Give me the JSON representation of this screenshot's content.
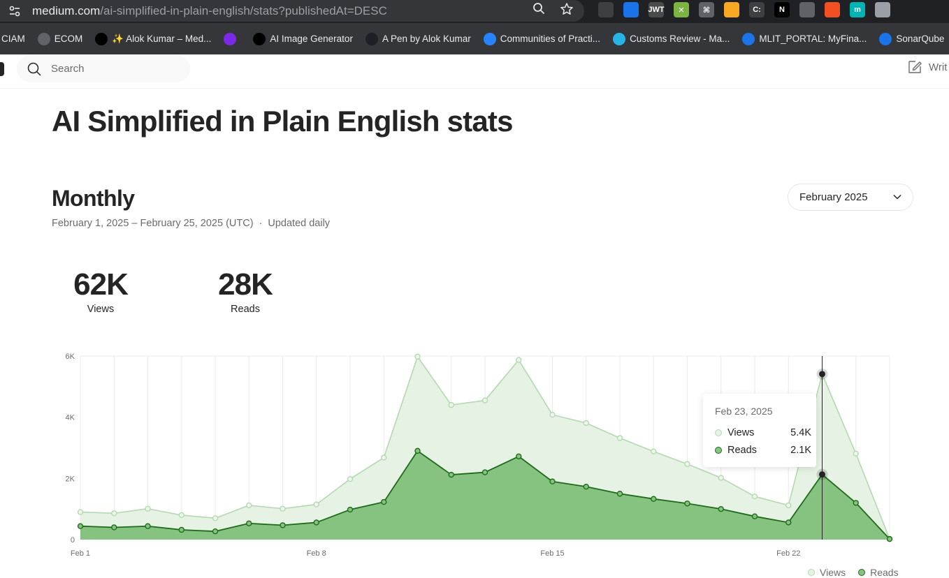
{
  "browser": {
    "url_host": "medium.com",
    "url_path": "/ai-simplified-in-plain-english/stats?publishedAt=DESC",
    "bookmarks": [
      {
        "label": "CIAM",
        "icon": "bookmark-icon",
        "color": "#35363a"
      },
      {
        "label": "ECOM",
        "icon": "globe-icon",
        "color": "#5f6368"
      },
      {
        "label": "✨ Alok Kumar – Med...",
        "icon": "medium-icon",
        "color": "#000000"
      },
      {
        "label": "",
        "icon": "canva-icon",
        "color": "#7d2ae8"
      },
      {
        "label": "AI Image Generator",
        "icon": "openai-icon",
        "color": "#000000"
      },
      {
        "label": "A Pen by Alok Kumar",
        "icon": "codepen-icon",
        "color": "#1e1f26"
      },
      {
        "label": "Communities of Practi...",
        "icon": "confluence-icon",
        "color": "#2684ff"
      },
      {
        "label": "Customs Review - Ma...",
        "icon": "star-icon",
        "color": "#27b5e8"
      },
      {
        "label": "MLIT_PORTAL: MyFina...",
        "icon": "wifi-icon",
        "color": "#1a73e8"
      },
      {
        "label": "SonarQube",
        "icon": "sonar-icon",
        "color": "#1a73e8"
      }
    ],
    "extensions": [
      {
        "icon": "lens-ext-icon",
        "color": "#3c4043",
        "text": ""
      },
      {
        "icon": "screenshot-ext-icon",
        "color": "#1a73e8",
        "text": ""
      },
      {
        "icon": "jwt-ext-icon",
        "color": "#4a4a4a",
        "text": "JWT"
      },
      {
        "icon": "tool-ext-icon",
        "color": "#7cb342",
        "text": "✕"
      },
      {
        "icon": "command-ext-icon",
        "color": "#5f6368",
        "text": "⌘"
      },
      {
        "icon": "balloon-ext-icon",
        "color": "#f9a825",
        "text": ""
      },
      {
        "icon": "code-ext-icon",
        "color": "#3c4043",
        "text": "C:"
      },
      {
        "icon": "notion-ext-icon",
        "color": "#000000",
        "text": "N"
      },
      {
        "icon": "bulb-ext-icon",
        "color": "#5f6368",
        "text": ""
      },
      {
        "icon": "microsoft-ext-icon",
        "color": "#f25022",
        "text": ""
      },
      {
        "icon": "m-ext-icon",
        "color": "#00b4b4",
        "text": "m"
      },
      {
        "icon": "vue-ext-icon",
        "color": "#9aa0a6",
        "text": ""
      }
    ]
  },
  "header": {
    "search_placeholder": "Search",
    "write_label": "Writ"
  },
  "page": {
    "title": "AI Simplified in Plain English stats",
    "section_title": "Monthly",
    "date_range": "February 1, 2025 – February 25, 2025 (UTC)",
    "update_note": "Updated daily",
    "month_selected": "February 2025"
  },
  "stats": {
    "views_total": "62K",
    "views_label": "Views",
    "reads_total": "28K",
    "reads_label": "Reads"
  },
  "tooltip": {
    "date": "Feb 23, 2025",
    "views_label": "Views",
    "views_value": "5.4K",
    "reads_label": "Reads",
    "reads_value": "2.1K"
  },
  "legend": {
    "views": "Views",
    "reads": "Reads"
  },
  "colors": {
    "views_line": "#b4d9b0",
    "views_fill": "#e6f2e4",
    "reads_line": "#1e6b1a",
    "reads_fill": "#86c280",
    "accent": "#1a8917"
  },
  "chart_data": {
    "type": "area",
    "x": [
      "Feb 1",
      "Feb 2",
      "Feb 3",
      "Feb 4",
      "Feb 5",
      "Feb 6",
      "Feb 7",
      "Feb 8",
      "Feb 9",
      "Feb 10",
      "Feb 11",
      "Feb 12",
      "Feb 13",
      "Feb 14",
      "Feb 15",
      "Feb 16",
      "Feb 17",
      "Feb 18",
      "Feb 19",
      "Feb 20",
      "Feb 21",
      "Feb 22",
      "Feb 23",
      "Feb 24",
      "Feb 25"
    ],
    "x_tick_labels": [
      "Feb 1",
      "Feb 8",
      "Feb 15",
      "Feb 22"
    ],
    "x_tick_indices": [
      0,
      7,
      14,
      21
    ],
    "y_tick_labels": [
      "0",
      "2K",
      "4K",
      "6K"
    ],
    "y_tick_values": [
      0,
      2000,
      4000,
      6000
    ],
    "ylim": [
      0,
      6000
    ],
    "grid": true,
    "legend_position": "bottom-right",
    "highlight_index": 22,
    "series": [
      {
        "name": "Views",
        "values": [
          900,
          860,
          1010,
          800,
          700,
          1120,
          1010,
          1150,
          1980,
          2680,
          5980,
          4400,
          4550,
          5870,
          4080,
          3810,
          3320,
          2880,
          2470,
          2020,
          1410,
          1120,
          5410,
          2810,
          20
        ]
      },
      {
        "name": "Reads",
        "values": [
          440,
          400,
          440,
          320,
          270,
          530,
          470,
          560,
          980,
          1230,
          2900,
          2120,
          2200,
          2720,
          1900,
          1730,
          1500,
          1330,
          1180,
          1000,
          760,
          560,
          2130,
          1200,
          20
        ]
      }
    ]
  }
}
